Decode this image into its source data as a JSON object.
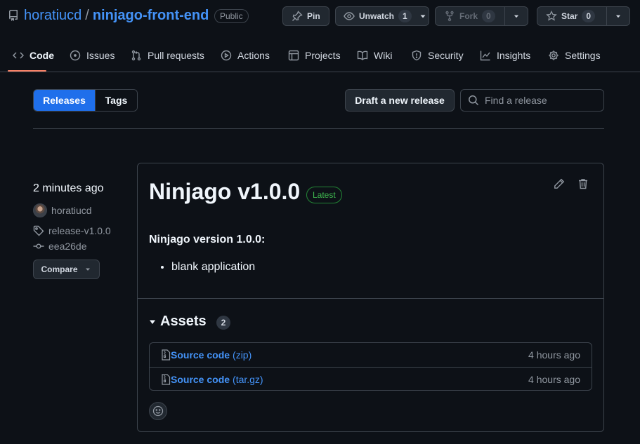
{
  "repo": {
    "owner": "horatiucd",
    "separator": "/",
    "name": "ninjago-front-end",
    "visibility": "Public"
  },
  "header_buttons": {
    "pin_label": "Pin",
    "unwatch_label": "Unwatch",
    "unwatch_count": "1",
    "fork_label": "Fork",
    "fork_count": "0",
    "star_label": "Star",
    "star_count": "0"
  },
  "tabs": [
    {
      "label": "Code",
      "icon": "code-icon",
      "active": true
    },
    {
      "label": "Issues",
      "icon": "issue-icon"
    },
    {
      "label": "Pull requests",
      "icon": "pull-request-icon"
    },
    {
      "label": "Actions",
      "icon": "play-icon"
    },
    {
      "label": "Projects",
      "icon": "table-icon"
    },
    {
      "label": "Wiki",
      "icon": "book-icon"
    },
    {
      "label": "Security",
      "icon": "shield-icon"
    },
    {
      "label": "Insights",
      "icon": "graph-icon"
    },
    {
      "label": "Settings",
      "icon": "gear-icon"
    }
  ],
  "subnav": {
    "releases_label": "Releases",
    "tags_label": "Tags",
    "draft_label": "Draft a new release",
    "search_placeholder": "Find a release"
  },
  "release": {
    "time_ago": "2 minutes ago",
    "author": "horatiucd",
    "tag": "release-v1.0.0",
    "commit": "eea26de",
    "compare_label": "Compare",
    "title": "Ninjago v1.0.0",
    "latest_badge": "Latest",
    "body_heading": "Ninjago version 1.0.0:",
    "body_items": [
      "blank application"
    ]
  },
  "assets": {
    "heading": "Assets",
    "count": "2",
    "items": [
      {
        "name": "Source code",
        "format": "(zip)",
        "time": "4 hours ago"
      },
      {
        "name": "Source code",
        "format": "(tar.gz)",
        "time": "4 hours ago"
      }
    ]
  },
  "colors": {
    "background": "#0d1117",
    "accent_blue": "#1f6feb",
    "link_blue": "#4493f8",
    "tab_underline": "#f78166",
    "latest_green": "#3fb950"
  }
}
